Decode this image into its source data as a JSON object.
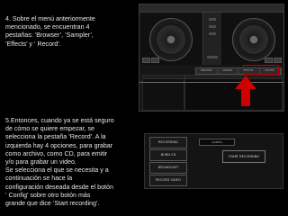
{
  "captions": {
    "top": "4. Sobre el menú anteriormente\nmencionado, se encuentran 4\npestañas: ‘Browser’, ‘Sampler’,\n‘Effects’ y ‘ Record’.",
    "bottom": "5.Entonces, cuando ya se está seguro\nde cómo se quiere empezar,  se\nselecciona la pestaña ‘Record’. A la\nizquierda hay 4 opciones, para grabar\ncomo archivo, como  CD, para emitir\ny/o para grabar un video.\nSe selecciona el  que se necesita y a\ncontinuación se hace  la\nconfiguración deseada desde el botón\n‘ Config’ sobre  otro botón más\ngrande que dice ‘Start recording’."
  },
  "dj_app": {
    "tabs": [
      "BROWSER",
      "SAMPLER",
      "EFFECTS",
      "RECORD"
    ]
  },
  "record_panel": {
    "options": [
      "RECORDING",
      "BURN CD",
      "BROADCAST",
      "RECORD VIDEO"
    ],
    "config_label": "CONFIG",
    "start_label": "START RECORDING"
  },
  "colors": {
    "background": "#000000",
    "caption_text": "#e6e6e6",
    "highlight": "#d00000"
  },
  "icons": {
    "pointer": "arrow-up-icon"
  }
}
